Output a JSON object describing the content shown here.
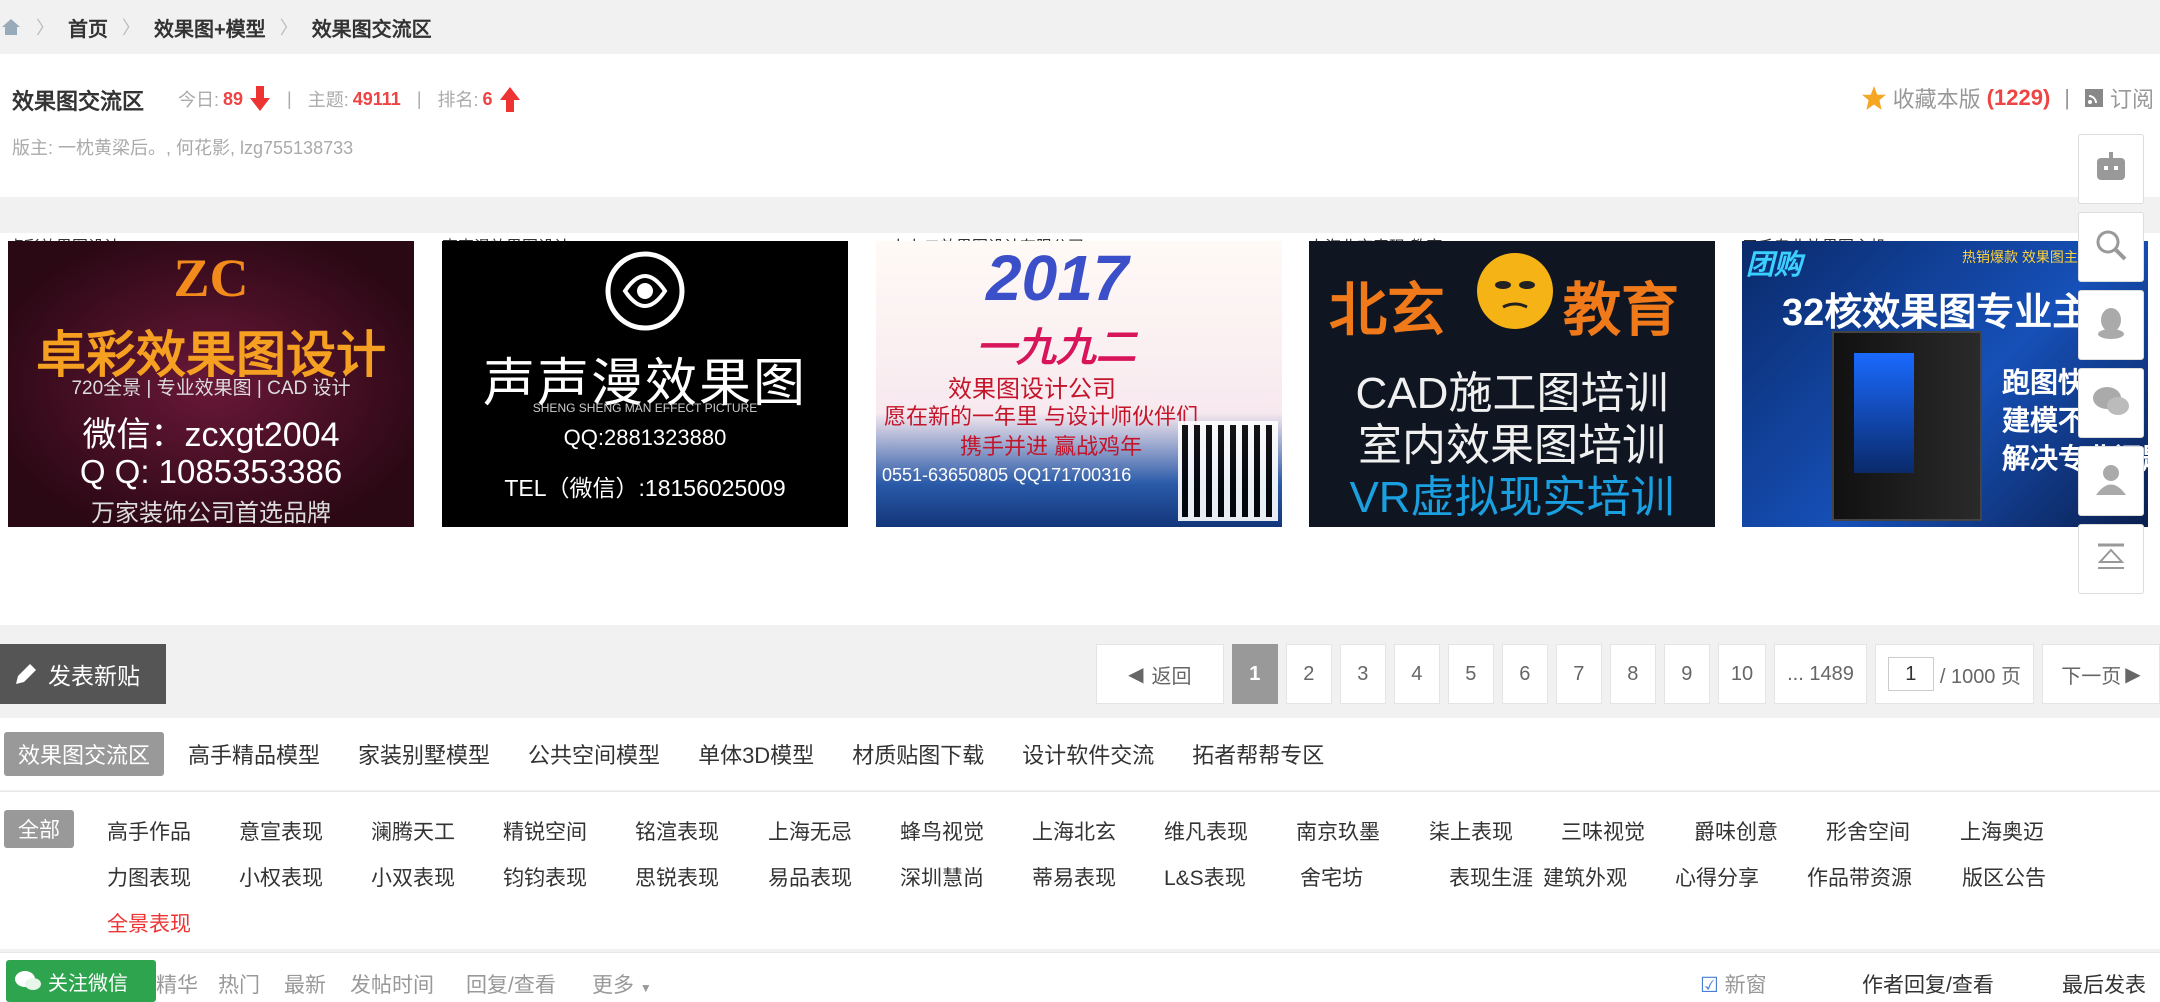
{
  "breadcrumb": [
    "首页",
    "效果图+模型",
    "效果图交流区"
  ],
  "forum": {
    "title": "效果图交流区",
    "today_label": "今日:",
    "today": "89",
    "topics_label": "主题:",
    "topics": "49111",
    "rank_label": "排名:",
    "rank": "6",
    "moderators": "版主: 一枕黄梁后。, 何花影, lzg755138733",
    "favorite_label": "收藏本版",
    "favorite_count": "(1229)",
    "subscribe_label": "订阅"
  },
  "ads": [
    {
      "caption": "卓彩效果图设计",
      "l1": "ZC",
      "l2": "卓彩效果图设计",
      "l3": "720全景 | 专业效果图 | CAD 设计",
      "l4": "微信：zcxgt2004",
      "l5": "Q Q: 1085353386",
      "l6": "万家装饰公司首选品牌"
    },
    {
      "caption": "声声漫效果图设计",
      "l1": "声声漫效果图",
      "l2": "SHENG SHENG MAN EFFECT PICTURE",
      "l3": "QQ:2881323880",
      "l4": "TEL（微信）:18156025009"
    },
    {
      "caption": "一九九二效果图设计有限公司",
      "l1": "2017",
      "l2": "一九九二",
      "l3": "效果图设计公司",
      "l4": "愿在新的一年里 与设计师伙伴们",
      "l5": "携手并进 赢战鸡年",
      "l6": "0551-63650805 QQ171700316"
    },
    {
      "caption": "上海北玄表现-教育",
      "l1": "北玄",
      "l2": "教育",
      "l3": "CAD施工图培训",
      "l4": "室内效果图培训",
      "l5": "VR虚拟现实培训"
    },
    {
      "caption": "三毛专业效果图主机",
      "l1": "团购",
      "l2": "热销爆款 效果图主",
      "l3": "32核效果图专业主",
      "l4": "跑图快",
      "l5": "建模不卡",
      "l6": "解决专业问题"
    }
  ],
  "toolbar": {
    "new_post": "发表新贴",
    "back": "返回",
    "pages": [
      "1",
      "2",
      "3",
      "4",
      "5",
      "6",
      "7",
      "8",
      "9",
      "10"
    ],
    "last_page": "... 1489",
    "page_input": "1",
    "page_total": "/ 1000 页",
    "next": "下一页"
  },
  "categories": [
    "效果图交流区",
    "高手精品模型",
    "家装别墅模型",
    "公共空间模型",
    "单体3D模型",
    "材质贴图下载",
    "设计软件交流",
    "拓者帮帮专区"
  ],
  "subcategories": {
    "all": "全部",
    "row1": [
      "高手作品",
      "意宣表现",
      "澜腾天工",
      "精锐空间",
      "铭渲表现",
      "上海无忌",
      "蜂鸟视觉",
      "上海北玄",
      "维凡表现",
      "南京玖墨",
      "柒上表现",
      "三味视觉",
      "爵味创意",
      "形舍空间",
      "上海奥迈"
    ],
    "row2": [
      "力图表现",
      "小权表现",
      "小双表现",
      "钧钧表现",
      "思锐表现",
      "易品表现",
      "深圳慧尚",
      "蒂易表现",
      "L&S表现",
      "舍宅坊",
      "表现生涯",
      "建筑外观",
      "心得分享",
      "作品带资源",
      "版区公告"
    ],
    "row3": [
      "全景表现"
    ]
  },
  "filters": {
    "wechat": "关注微信",
    "items": [
      "精华",
      "热门",
      "最新",
      "发帖时间",
      "回复/查看",
      "更多"
    ],
    "new_window": "新窗",
    "author_reply": "作者回复/查看",
    "last_post": "最后发表"
  },
  "colors": {
    "accent_red": "#e44444",
    "gray_active": "#999999",
    "wechat_green": "#2ea44f"
  }
}
